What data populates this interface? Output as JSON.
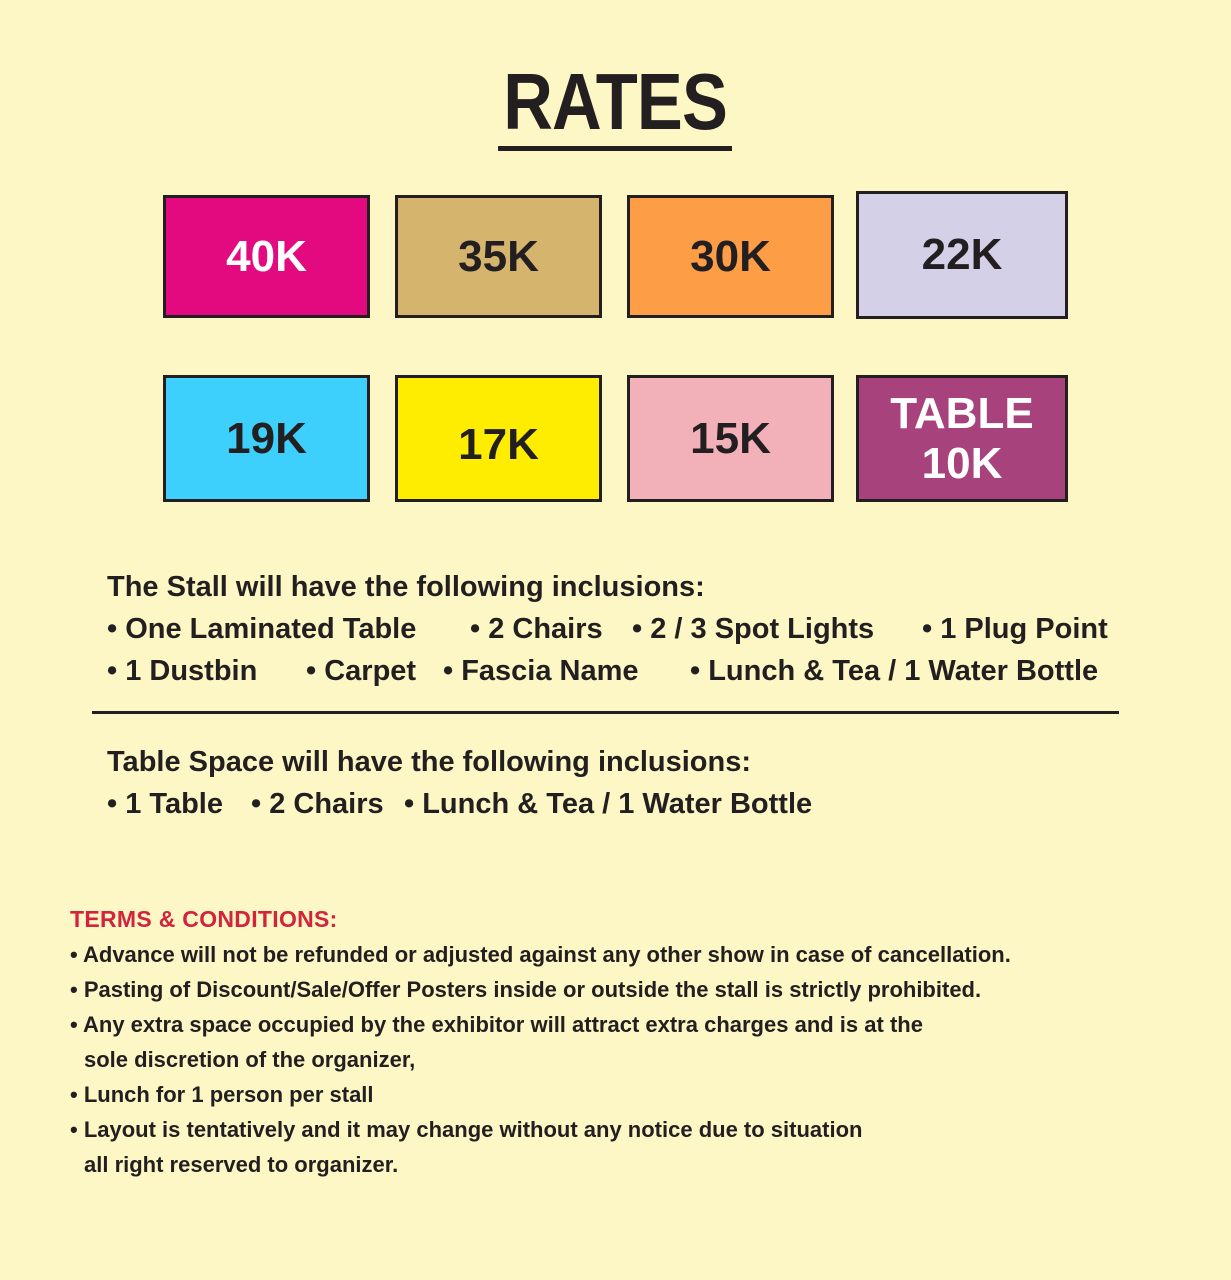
{
  "title": "RATES",
  "rates": [
    {
      "label": "40K",
      "bg": "#e3097f",
      "fg": "#ffffff"
    },
    {
      "label": "35K",
      "bg": "#d5b46d",
      "fg": "#231f20"
    },
    {
      "label": "30K",
      "bg": "#fd9e46",
      "fg": "#231f20"
    },
    {
      "label": "22K",
      "bg": "#d3d0e8",
      "fg": "#231f20"
    },
    {
      "label": "19K",
      "bg": "#3dd0fc",
      "fg": "#231f20"
    },
    {
      "label": "17K",
      "bg": "#ffed00",
      "fg": "#231f20"
    },
    {
      "label": "15K",
      "bg": "#f2b1b9",
      "fg": "#231f20"
    },
    {
      "label_line1": "TABLE",
      "label_line2": "10K",
      "bg": "#a8427d",
      "fg": "#ffffff"
    }
  ],
  "stall_inclusions": {
    "heading": "The Stall will have the following inclusions:",
    "items": [
      "• One Laminated Table",
      "• 2 Chairs",
      "• 2 / 3 Spot Lights",
      "• 1 Plug Point",
      "• 1 Dustbin",
      "• Carpet",
      "• Fascia Name",
      "• Lunch & Tea / 1 Water Bottle"
    ]
  },
  "table_inclusions": {
    "heading": "Table Space will have the following inclusions:",
    "items": [
      "• 1 Table",
      "• 2 Chairs",
      "• Lunch & Tea / 1 Water Bottle"
    ]
  },
  "terms": {
    "heading": "TERMS & CONDITIONS:",
    "items": [
      "• Advance will not be refunded or adjusted against any other show in case of cancellation.",
      "• Pasting of Discount/Sale/Offer Posters inside or outside the stall is strictly prohibited.",
      "• Any extra space occupied by the exhibitor will attract extra charges and is at the",
      "sole discretion of the organizer,",
      "• Lunch for 1 person per stall",
      "• Layout is tentatively and it may change without any notice due to situation",
      "all right reserved to organizer."
    ]
  },
  "colors": {
    "background": "#fcf7c4",
    "text": "#231f20",
    "terms_heading": "#d2233f"
  }
}
